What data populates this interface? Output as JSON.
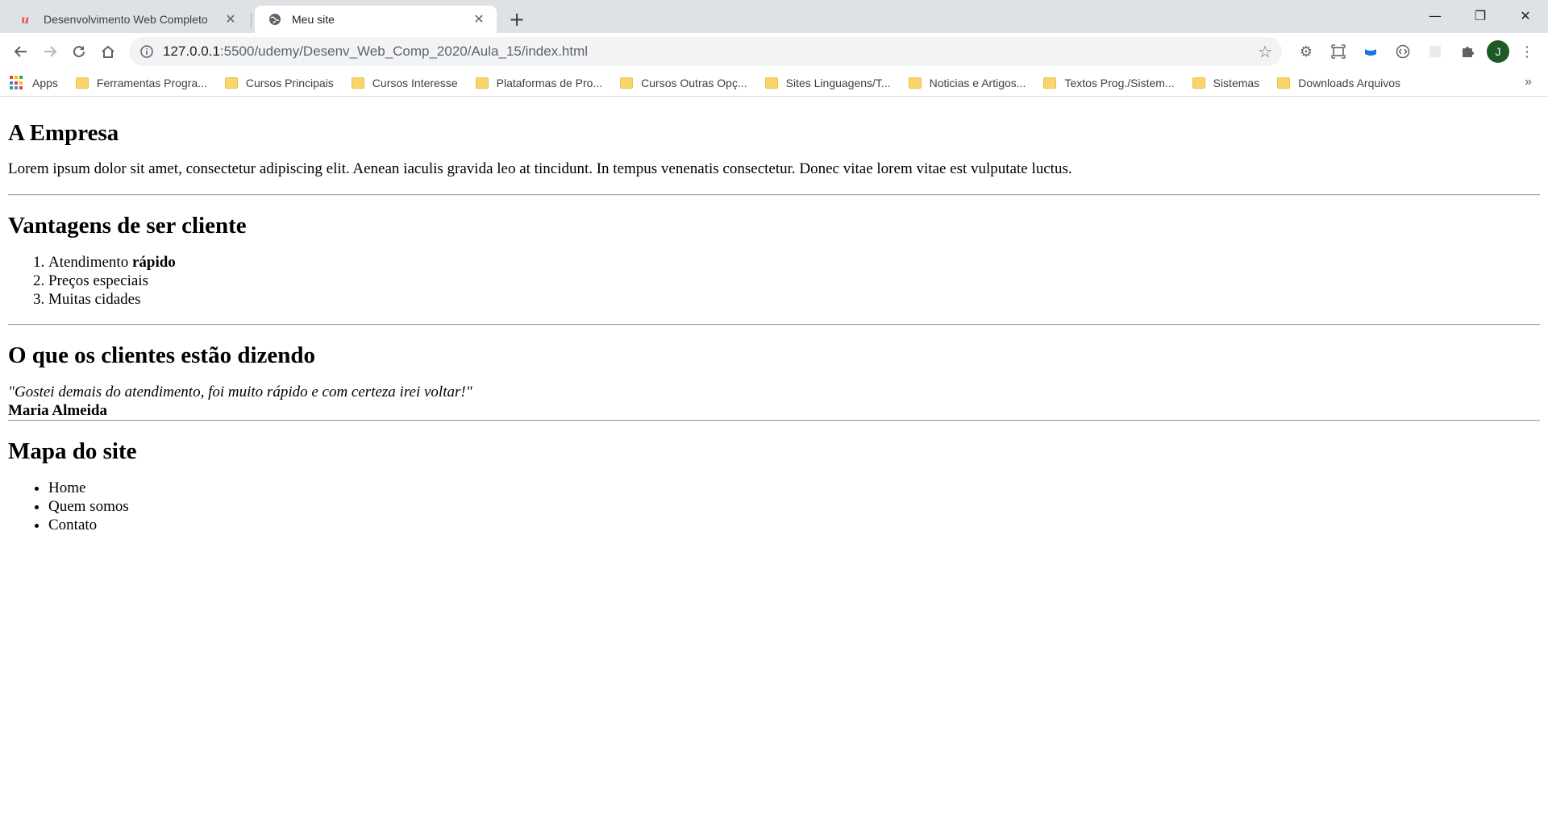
{
  "browser": {
    "tabs": [
      {
        "title": "Desenvolvimento Web Completo",
        "close": "✕",
        "active": false
      },
      {
        "title": "Meu site",
        "close": "✕",
        "active": true
      }
    ],
    "new_tab": "+",
    "window_controls": {
      "minimize": "—",
      "restore": "❐",
      "close": "✕"
    },
    "address": {
      "host": "127.0.0.1",
      "path": ":5500/udemy/Desenv_Web_Comp_2020/Aula_15/index.html"
    },
    "avatar_letter": "J",
    "bookmarks": [
      "Apps",
      "Ferramentas Progra...",
      "Cursos Principais",
      "Cursos Interesse",
      "Plataformas de Pro...",
      "Cursos Outras Opç...",
      "Sites Linguagens/T...",
      "Noticias e Artigos...",
      "Textos Prog./Sistem...",
      "Sistemas",
      "Downloads Arquivos"
    ],
    "bookmarks_more": "»"
  },
  "page": {
    "empresa": {
      "title": "A Empresa",
      "text": "Lorem ipsum dolor sit amet, consectetur adipiscing elit. Aenean iaculis gravida leo at tincidunt. In tempus venenatis consectetur. Donec vitae lorem vitae est vulputate luctus."
    },
    "vantagens": {
      "title": "Vantagens de ser cliente",
      "item1_prefix": "Atendimento ",
      "item1_bold": "rápido",
      "item2": "Preços especiais",
      "item3": "Muitas cidades"
    },
    "depoimentos": {
      "title": "O que os clientes estão dizendo",
      "quote": "\"Gostei demais do atendimento, foi muito rápido e com certeza irei voltar!\"",
      "author": "Maria Almeida"
    },
    "mapa": {
      "title": "Mapa do site",
      "items": [
        "Home",
        "Quem somos",
        "Contato"
      ]
    }
  }
}
